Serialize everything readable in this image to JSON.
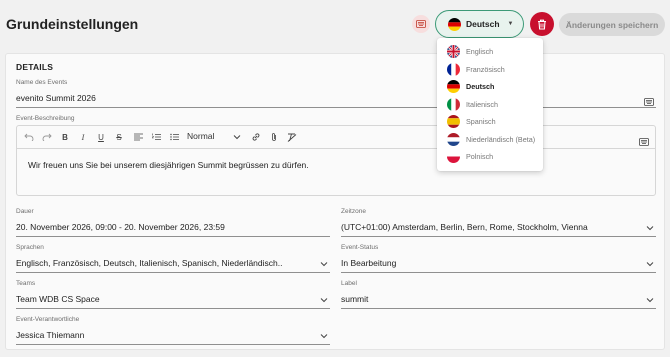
{
  "header": {
    "title": "Grundeinstellungen",
    "language_button": {
      "label": "Deutsch",
      "flag": "de"
    },
    "save_label": "Änderungen speichern"
  },
  "language_menu": {
    "items": [
      {
        "label": "Englisch",
        "flag": "gb",
        "active": false
      },
      {
        "label": "Französisch",
        "flag": "fr",
        "active": false
      },
      {
        "label": "Deutsch",
        "flag": "de",
        "active": true
      },
      {
        "label": "Italienisch",
        "flag": "it",
        "active": false
      },
      {
        "label": "Spanisch",
        "flag": "es",
        "active": false
      },
      {
        "label": "Niederländisch (Beta)",
        "flag": "nl",
        "active": false
      },
      {
        "label": "Polnisch",
        "flag": "pl",
        "active": false
      }
    ]
  },
  "details": {
    "section_title": "DETAILS",
    "event_name": {
      "label": "Name des Events",
      "value": "evenito Summit 2026"
    },
    "description": {
      "label": "Event-Beschreibung",
      "text_style": "Normal",
      "text": "Wir freuen uns Sie bei unserem diesjährigen Summit begrüssen zu dürfen."
    },
    "duration": {
      "label": "Dauer",
      "value": "20. November 2026, 09:00 - 20. November 2026, 23:59"
    },
    "timezone": {
      "label": "Zeitzone",
      "value": "(UTC+01:00) Amsterdam, Berlin, Bern, Rome, Stockholm, Vienna"
    },
    "languages": {
      "label": "Sprachen",
      "value": "Englisch, Französisch, Deutsch, Italienisch, Spanisch, Niederländisch.."
    },
    "status": {
      "label": "Event-Status",
      "value": "In Bearbeitung"
    },
    "teams": {
      "label": "Teams",
      "value": "Team WDB CS Space"
    },
    "tag": {
      "label": "Label",
      "value": "summit"
    },
    "owner": {
      "label": "Event-Verantwortliche",
      "value": "Jessica Thiemann"
    }
  },
  "colors": {
    "accent_green": "#3c9a77",
    "delete_red": "#c8102e",
    "save_disabled_bg": "#dadada"
  },
  "icons": [
    "translate-icon",
    "chevron-down-icon",
    "trash-icon",
    "undo-icon",
    "redo-icon",
    "bold-icon",
    "italic-icon",
    "underline-icon",
    "strikethrough-icon",
    "align-left-icon",
    "ordered-list-icon",
    "bullet-list-icon",
    "link-icon",
    "attachment-icon",
    "clear-format-icon"
  ]
}
